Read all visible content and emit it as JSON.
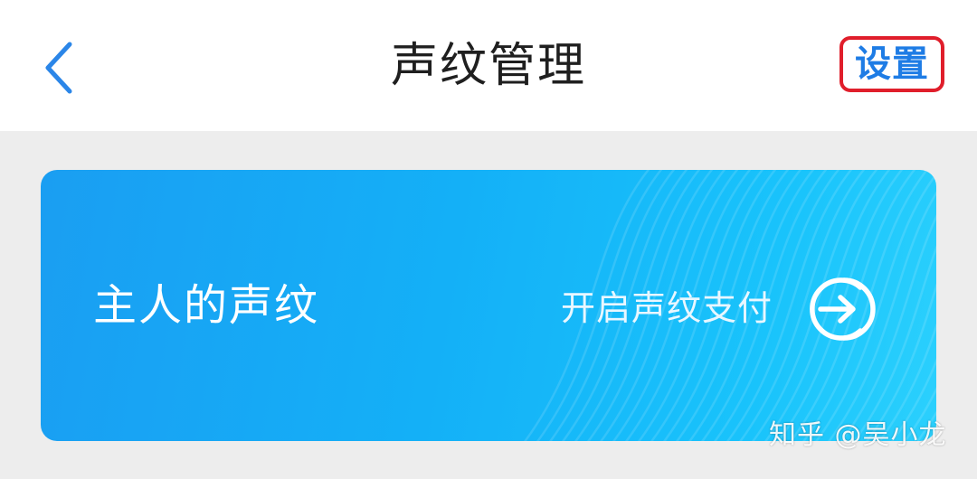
{
  "header": {
    "title": "声纹管理",
    "back_icon": "chevron-left-icon",
    "settings_label": "设置",
    "highlight_color": "#e01e2b",
    "accent_color": "#1e7ce5"
  },
  "card": {
    "owner_label": "主人的声纹",
    "action_label": "开启声纹支付",
    "action_icon": "arrow-right-circle-icon",
    "gradient_start": "#1a9ef2",
    "gradient_end": "#2bd0fd"
  },
  "watermark": {
    "text": "知乎 @吴小龙"
  }
}
